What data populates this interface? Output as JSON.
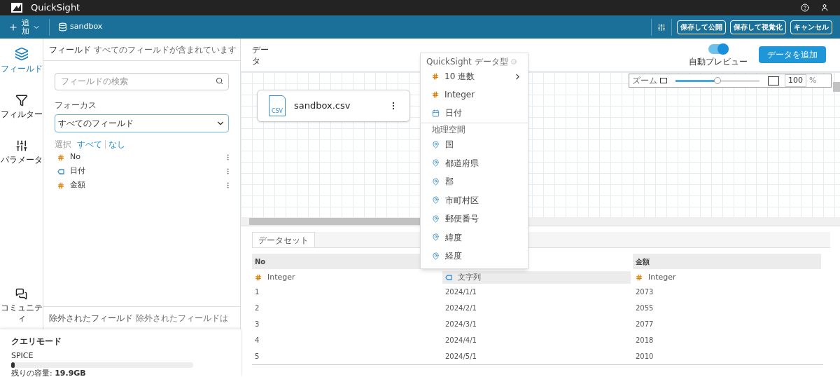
{
  "app": {
    "title": "QuickSight"
  },
  "toolbar": {
    "add_label": "追加",
    "dataset": "sandbox",
    "buttons": [
      "保存して公開",
      "保存して視覚化",
      "キャンセル"
    ]
  },
  "rail": [
    {
      "label": "フィールド",
      "selected": true,
      "kind": "fields"
    },
    {
      "label": "フィルター",
      "selected": false,
      "kind": "filter"
    },
    {
      "label": "パラメータ",
      "selected": false,
      "kind": "params"
    },
    {
      "label": "コミュニティ",
      "selected": false,
      "kind": "community"
    }
  ],
  "fields_panel": {
    "title": "フィールド",
    "subtitle": "すべてのフィールドが含まれています",
    "search_placeholder": "フィールドの検索",
    "focus_label": "フォーカス",
    "focus_value": "すべてのフィールド",
    "select_label": "選択",
    "select_all": "すべて",
    "select_none": "なし",
    "fields": [
      {
        "name": "No",
        "kind": "number"
      },
      {
        "name": "日付",
        "kind": "string"
      },
      {
        "name": "金額",
        "kind": "number"
      }
    ],
    "excluded_title": "除外されたフィールド",
    "excluded_subtitle": "除外されたフィールドは"
  },
  "query_mode": {
    "title": "クエリモード",
    "mode": "SPICE",
    "level": 0.02,
    "capacity": "残りの容量: **19.9GB**"
  },
  "data_header": {
    "title": "データ",
    "auto_preview_label": "自動プレビュー",
    "auto_preview_on": true,
    "add_data": "データを追加"
  },
  "zoom": {
    "label": "ズーム",
    "level": 0.5,
    "value": "100",
    "unit": "%"
  },
  "canvas": {
    "node": "sandbox.csv",
    "file_icon_label": "CSV"
  },
  "type_menu": {
    "title": "QuickSight データ型",
    "items": [
      {
        "label": "10 進数",
        "kind": "number",
        "submenu": true
      },
      {
        "label": "Integer",
        "kind": "number",
        "submenu": false
      },
      {
        "label": "日付",
        "kind": "date",
        "submenu": false
      }
    ],
    "geo_title": "地理空間",
    "geo_items": [
      "国",
      "都道府県",
      "郡",
      "市町村区",
      "郵便番号",
      "緯度",
      "経度"
    ]
  },
  "dataset_tab": {
    "label": "データセット",
    "selected": true
  },
  "table": {
    "columns": [
      {
        "name": "No",
        "type": "Integer",
        "kind": "number",
        "selected": false
      },
      {
        "type": "文字列",
        "kind": "string",
        "selected": true
      },
      {
        "name": "金額",
        "type": "Integer",
        "kind": "number",
        "selected": false
      }
    ],
    "rows": [
      [
        "1",
        "2024/1/1",
        "2073"
      ],
      [
        "2",
        "2024/2/1",
        "2055"
      ],
      [
        "3",
        "2024/3/1",
        "2077"
      ],
      [
        "4",
        "2024/4/1",
        "2018"
      ],
      [
        "5",
        "2024/5/1",
        "2010"
      ]
    ]
  }
}
